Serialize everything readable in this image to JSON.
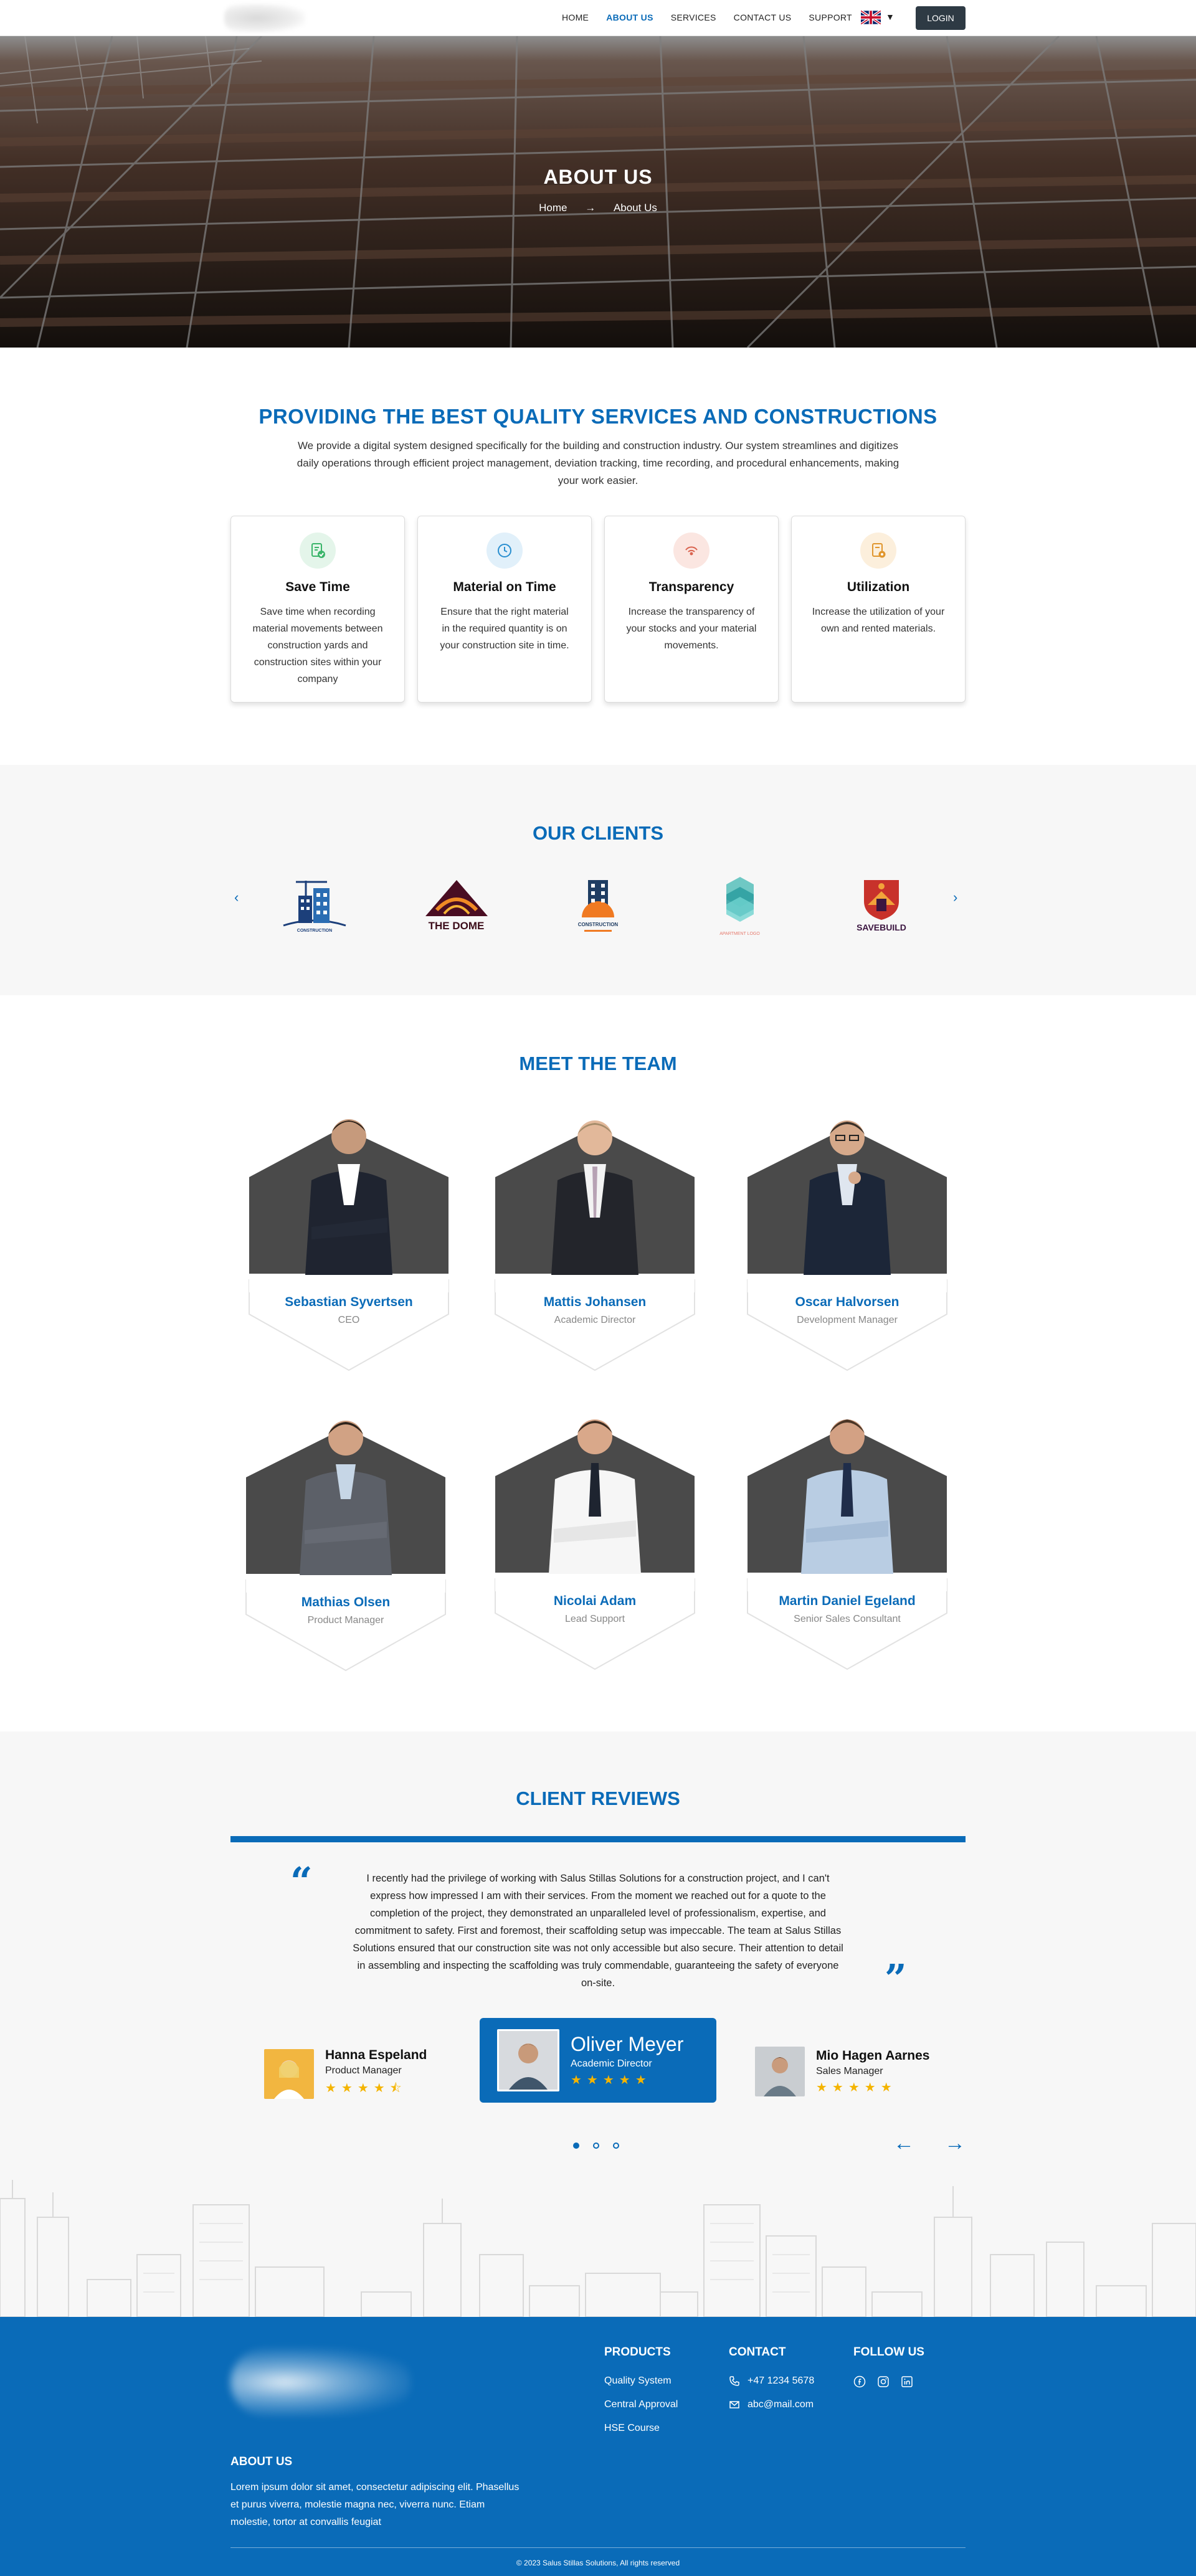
{
  "nav": {
    "links": [
      "HOME",
      "ABOUT US",
      "SERVICES",
      "CONTACT US",
      "SUPPORT"
    ],
    "active": "ABOUT US",
    "login": "LOGIN"
  },
  "hero": {
    "title": "ABOUT US",
    "crumb_home": "Home",
    "crumb_arrow": "→",
    "crumb_current": "About Us"
  },
  "services": {
    "title": "PROVIDING THE BEST QUALITY SERVICES AND CONSTRUCTIONS",
    "description": "We provide a digital system designed specifically for the building and construction industry. Our system streamlines and digitizes daily operations through efficient project management, deviation tracking, time recording, and procedural enhancements, making your work easier.",
    "cards": [
      {
        "title": "Save Time",
        "text": "Save time when recording material movements between construction yards and construction sites within your company",
        "icon": "document-check-icon",
        "color": "#3bb56a",
        "bg": "#e4f5ea"
      },
      {
        "title": "Material on Time",
        "text": "Ensure that the right material in the required quantity is on your construction site in time.",
        "icon": "clock-icon",
        "color": "#2a8fd0",
        "bg": "#e1f0fa"
      },
      {
        "title": "Transparency",
        "text": "Increase the transparency of your stocks and your material movements.",
        "icon": "signal-icon",
        "color": "#d9634f",
        "bg": "#fbe6e1"
      },
      {
        "title": "Utilization",
        "text": "Increase the utilization of your own and rented materials.",
        "icon": "document-settings-icon",
        "color": "#e0962e",
        "bg": "#fcefdc"
      }
    ]
  },
  "clients": {
    "title": "OUR CLIENTS",
    "prev": "‹",
    "next": "›",
    "logos": [
      {
        "name": "construction-logo-1",
        "text": "CONSTRUCTION"
      },
      {
        "name": "the-dome-logo",
        "text": "THE DOME"
      },
      {
        "name": "construction-logo-2",
        "text": "CONSTRUCTION"
      },
      {
        "name": "apartment-logo",
        "text": "APARTMENT LOGO"
      },
      {
        "name": "savebuild-logo",
        "text": "SAVEBUILD"
      }
    ]
  },
  "team": {
    "title": "MEET THE TEAM",
    "members": [
      {
        "name": "Sebastian Syvertsen",
        "role": "CEO"
      },
      {
        "name": "Mattis Johansen",
        "role": "Academic Director"
      },
      {
        "name": "Oscar Halvorsen",
        "role": "Development Manager"
      },
      {
        "name": "Mathias Olsen",
        "role": "Product Manager"
      },
      {
        "name": "Nicolai Adam",
        "role": "Lead Support"
      },
      {
        "name": "Martin Daniel Egeland",
        "role": "Senior Sales Consultant"
      }
    ]
  },
  "reviews": {
    "title": "CLIENT REVIEWS",
    "open_quote": "“",
    "close_quote": "”",
    "text": "I recently had the privilege of working with Salus Stillas Solutions for a construction project, and I can't express how impressed I am with their services. From the moment we reached out for a quote to the completion of the project, they demonstrated an unparalleled level of professionalism, expertise, and commitment to safety. First and foremost, their scaffolding setup was impeccable. The team at Salus Stillas Solutions ensured that our construction site was not only accessible but also secure. Their attention to detail in assembling and inspecting the scaffolding was truly commendable, guaranteeing the safety of everyone on-site.",
    "reviewers": [
      {
        "name": "Hanna Espeland",
        "role": "Product Manager",
        "rating": 4.5,
        "stars": "★★★★⯪"
      },
      {
        "name": "Oliver Meyer",
        "role": "Academic Director",
        "rating": 5,
        "stars": "★★★★★"
      },
      {
        "name": "Mio Hagen Aarnes",
        "role": "Sales Manager",
        "rating": 5,
        "stars": "★★★★★"
      }
    ],
    "active_index": 1,
    "pages": 3,
    "prev_arrow": "←",
    "next_arrow": "→"
  },
  "footer": {
    "about_title": "ABOUT US",
    "about_text": "Lorem ipsum dolor sit amet, consectetur adipiscing elit. Phasellus et purus viverra, molestie magna nec, viverra nunc. Etiam molestie, tortor at convallis feugiat",
    "products_title": "PRODUCTS",
    "products": [
      "Quality System",
      "Central Approval",
      "HSE Course"
    ],
    "contact_title": "CONTACT",
    "phone": "+47 1234 5678",
    "email": "abc@mail.com",
    "follow_title": "FOLLOW US",
    "social": [
      "facebook-icon",
      "instagram-icon",
      "linkedin-icon"
    ],
    "copyright": "2023 Salus Stillas Solutions, All rights reserved"
  },
  "colors": {
    "brand_blue": "#0a6bb8",
    "login_bg": "#2e3a44",
    "star": "#f4b400"
  }
}
